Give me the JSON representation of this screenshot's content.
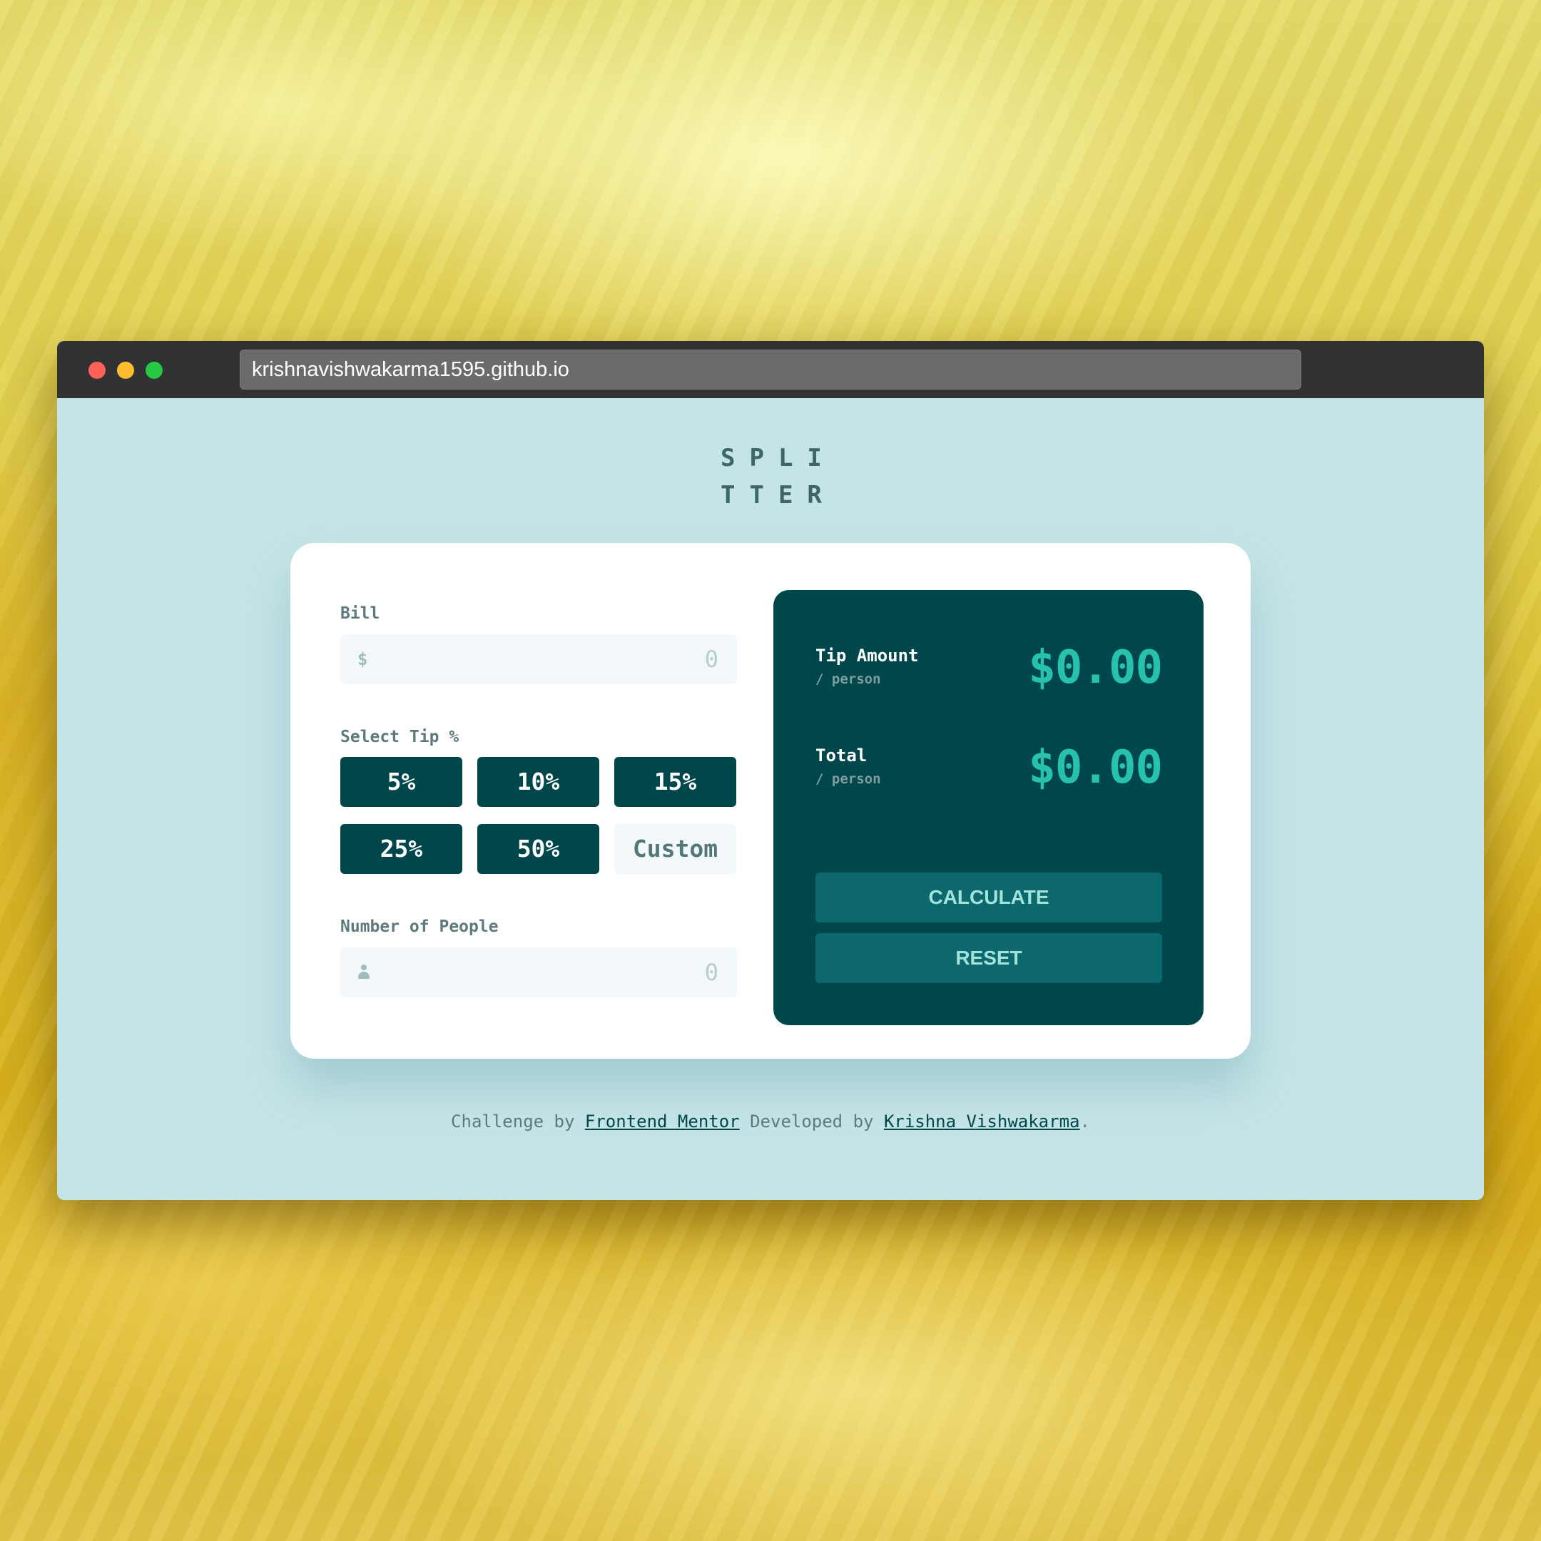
{
  "browser": {
    "url": "krishnavishwakarma1595.github.io"
  },
  "logo": {
    "line1": "SPLI",
    "line2": "TTER"
  },
  "bill": {
    "label": "Bill",
    "prefix": "$",
    "placeholder": "0"
  },
  "tip": {
    "label": "Select Tip %",
    "options": [
      "5%",
      "10%",
      "15%",
      "25%",
      "50%"
    ],
    "custom_label": "Custom"
  },
  "people": {
    "label": "Number of People",
    "placeholder": "0",
    "icon": "person-icon"
  },
  "results": {
    "tip_amount_label": "Tip Amount",
    "tip_amount_sub": "/ person",
    "tip_amount_value": "$0.00",
    "total_label": "Total",
    "total_sub": "/ person",
    "total_value": "$0.00",
    "calculate_label": "CALCULATE",
    "reset_label": "RESET"
  },
  "footer": {
    "text1": "Challenge by ",
    "link1": "Frontend Mentor",
    "text2": " Developed by ",
    "link2": "Krishna Vishwakarma",
    "text3": "."
  },
  "colors": {
    "page_bg": "#c5e4e7",
    "dark_green": "#00474b",
    "accent": "#26c2ae",
    "button_teal": "#0d686d"
  }
}
